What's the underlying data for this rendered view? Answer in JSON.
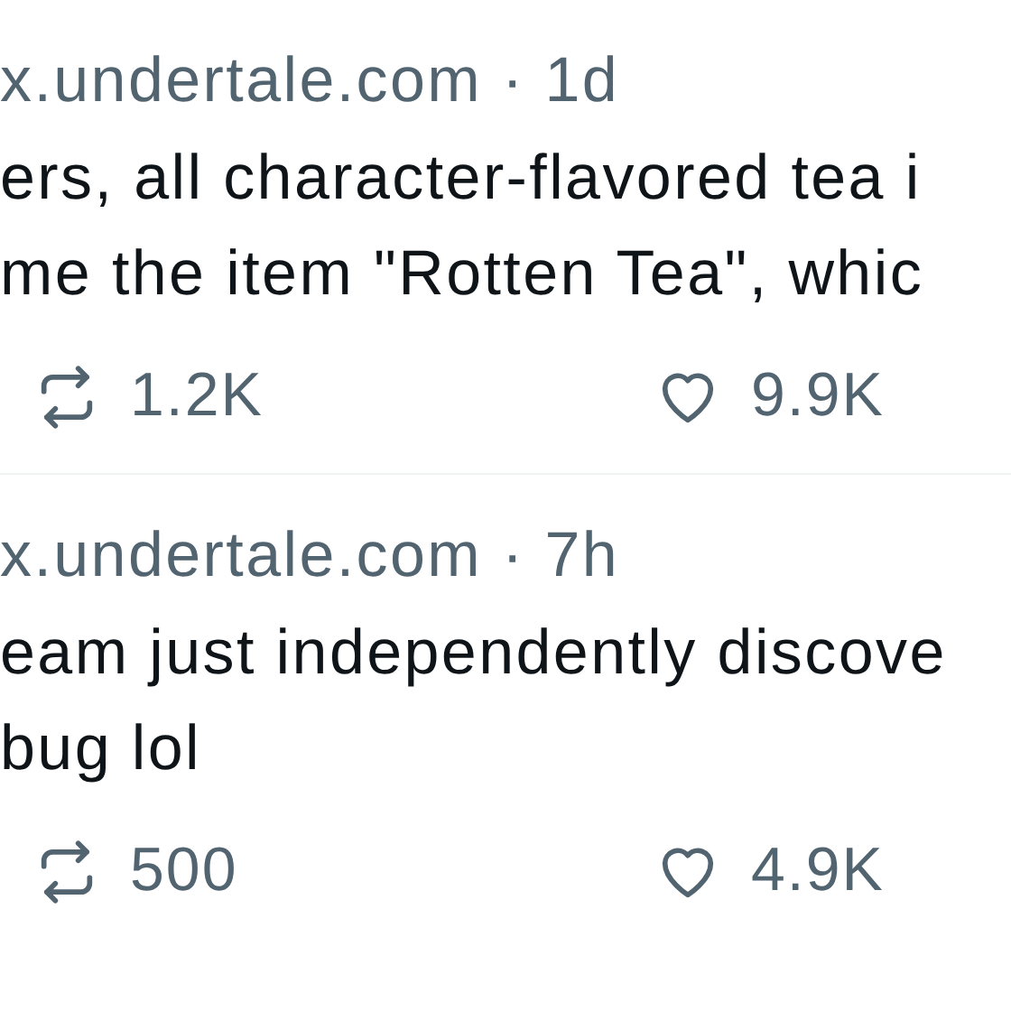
{
  "posts": [
    {
      "header": "x.undertale.com · 1d",
      "lines": [
        "ers, all character-flavored tea i",
        "me the item \"Rotten Tea\", whic"
      ],
      "reposts": "1.2K",
      "likes": "9.9K"
    },
    {
      "header": "x.undertale.com · 7h",
      "lines": [
        "eam just independently discove",
        "bug lol"
      ],
      "reposts": "500",
      "likes": "4.9K"
    }
  ]
}
